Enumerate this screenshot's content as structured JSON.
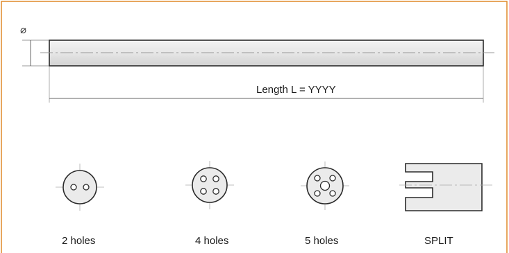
{
  "frame_color": "#e08a2a",
  "rod": {
    "diameter_symbol": "⌀",
    "length_label": "Length L = YYYY"
  },
  "sections": [
    {
      "label": "2 holes",
      "icon": "two-hole-cross-section-icon"
    },
    {
      "label": "4 holes",
      "icon": "four-hole-cross-section-icon"
    },
    {
      "label": "5 holes",
      "icon": "five-hole-cross-section-icon"
    },
    {
      "label": "SPLIT",
      "icon": "split-end-icon"
    }
  ]
}
